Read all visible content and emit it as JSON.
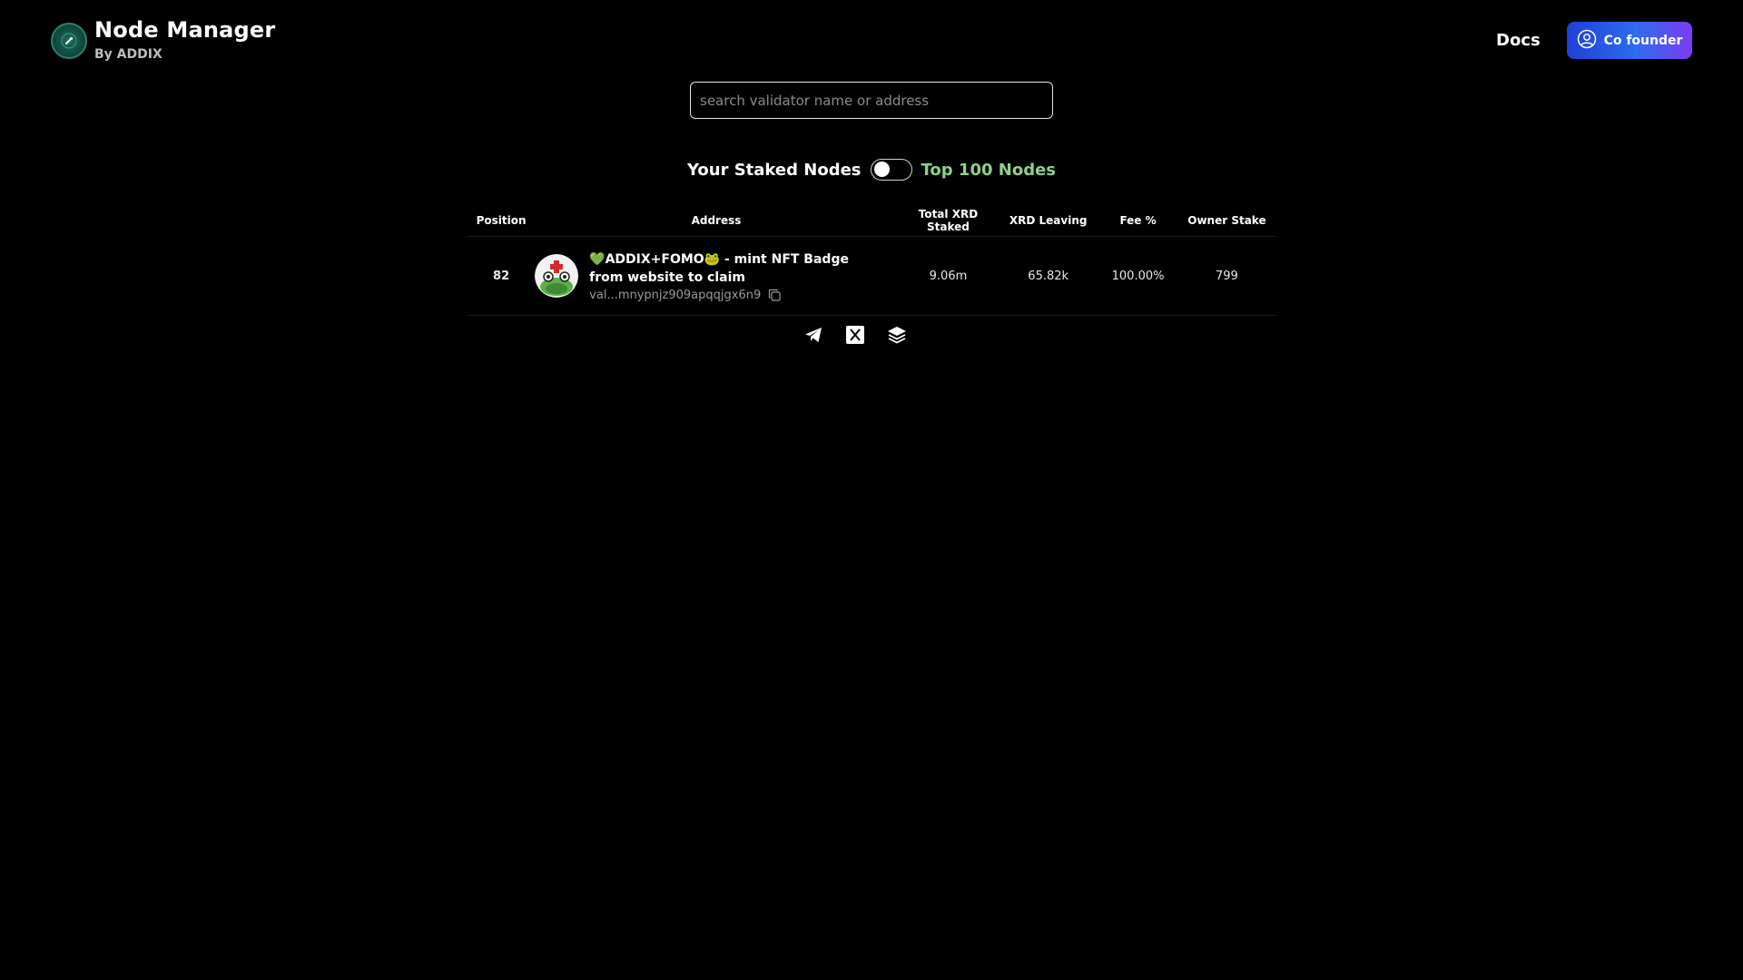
{
  "header": {
    "title": "Node Manager",
    "subtitle": "By ADDIX",
    "docs_label": "Docs",
    "cofounder_label": "Co founder"
  },
  "search": {
    "placeholder": "search validator name or address",
    "value": ""
  },
  "toggle": {
    "left_label": "Your Staked Nodes",
    "right_label": "Top 100 Nodes",
    "state": "top-100"
  },
  "table": {
    "columns": [
      "Position",
      "Address",
      "Total XRD Staked",
      "XRD Leaving",
      "Fee %",
      "Owner Stake"
    ],
    "rows": [
      {
        "position": "82",
        "name": "💚ADDIX+FOMO🐸 - mint NFT Badge from website to claim",
        "address": "val...mnypnjz909apqqjgx6n9",
        "total_staked": "9.06m",
        "xrd_leaving": "65.82k",
        "fee": "100.00%",
        "owner_stake": "799"
      }
    ]
  },
  "footer": {
    "icons": [
      "telegram-icon",
      "x-icon",
      "layers-icon"
    ]
  },
  "colors": {
    "background": "#000000",
    "accent_green": "#8fd08a",
    "button_gradient_start": "#1e3fd6",
    "button_gradient_end": "#7c3bf2"
  }
}
